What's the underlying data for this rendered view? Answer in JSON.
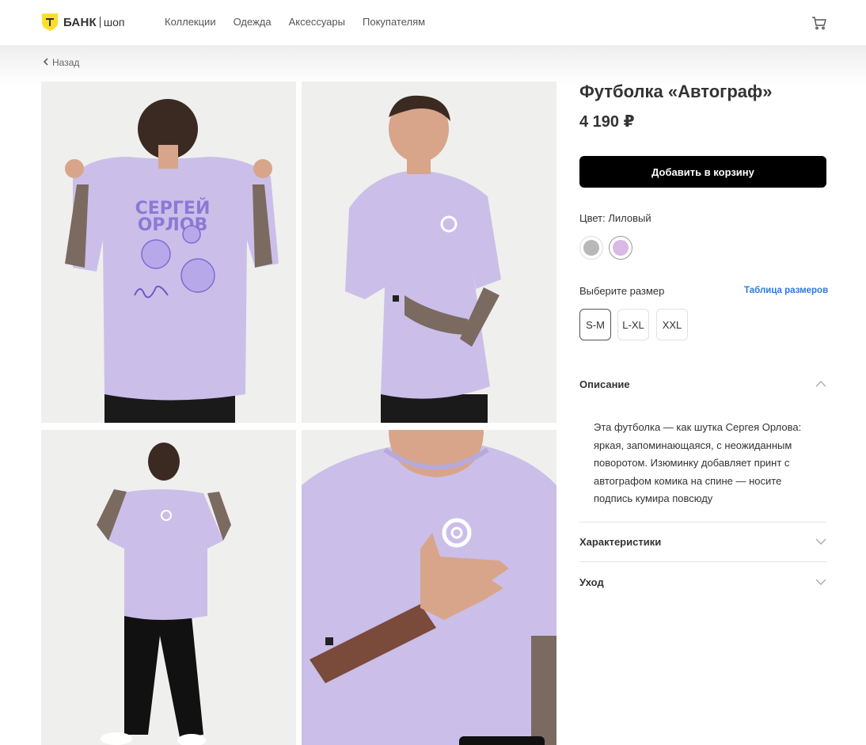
{
  "header": {
    "logo_brand": "БАНК",
    "logo_shop": "шоп",
    "nav": [
      "Коллекции",
      "Одежда",
      "Аксессуары",
      "Покупателям"
    ],
    "cart_icon": "cart-icon"
  },
  "back_label": "Назад",
  "gallery": {
    "print_line1": "СЕРГЕЙ",
    "print_line2": "ОРЛОВ"
  },
  "product": {
    "title": "Футболка «Автограф»",
    "price": "4 190 ₽",
    "add_to_cart": "Добавить в корзину",
    "color_label": "Цвет: Лиловый",
    "colors": [
      "#b8b8b8",
      "#d9b9e6"
    ],
    "size_label": "Выберите размер",
    "size_table": "Таблица размеров",
    "sizes": [
      "S-M",
      "L-XL",
      "XXL"
    ],
    "selected_size": "S-M"
  },
  "accordion": {
    "description_title": "Описание",
    "description_text": "Эта футболка — как шутка Сергея Орлова: яркая, запоминающаяся, с неожиданным поворотом. Изюминку добавляет принт с автографом комика на спине — носите подпись кумира повсюду",
    "characteristics_title": "Характеристики",
    "care_title": "Уход"
  },
  "colors": {
    "accent": "#ffdd2d",
    "button": "#000000",
    "link": "#2a7ae2",
    "shirt": "#cbbfe9"
  }
}
